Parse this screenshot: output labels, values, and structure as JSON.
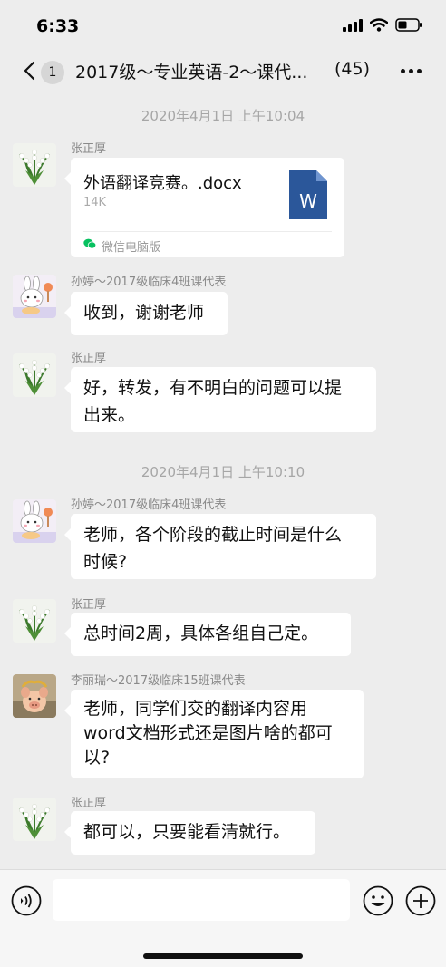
{
  "status_bar": {
    "time": "6:33"
  },
  "nav": {
    "unread_badge": "1",
    "title": "2017级～专业英语-2～课代...",
    "member_count": "(45)"
  },
  "messages": [
    {
      "timestamp": "2020年4月1日 上午10:04",
      "sender": "张正厚",
      "file": {
        "name": "外语翻译竞赛。.docx",
        "size": "14K",
        "source": "微信电脑版",
        "icon_letter": "W"
      }
    },
    {
      "sender": "孙婷～2017级临床4班课代表",
      "text": "收到，谢谢老师"
    },
    {
      "sender": "张正厚",
      "lines": [
        "好，转发，有不明白的问题可以提",
        "出来。"
      ]
    },
    {
      "timestamp": "2020年4月1日 上午10:10",
      "sender": "孙婷～2017级临床4班课代表",
      "lines": [
        "老师，各个阶段的截止时间是什么",
        "时候?"
      ]
    },
    {
      "sender": "张正厚",
      "text": "总时间2周，具体各组自己定。"
    },
    {
      "sender": "李丽瑞～2017级临床15班课代表",
      "lines": [
        "老师，同学们交的翻译内容用",
        "word文档形式还是图片啥的都可",
        "以?"
      ]
    },
    {
      "sender": "张正厚",
      "text": "都可以，只要能看清就行。"
    }
  ],
  "input_bar": {
    "placeholder": ""
  },
  "colors": {
    "background": "#ededed",
    "bubble": "#ffffff",
    "word_blue": "#2b579a",
    "wechat_green": "#07c160"
  }
}
